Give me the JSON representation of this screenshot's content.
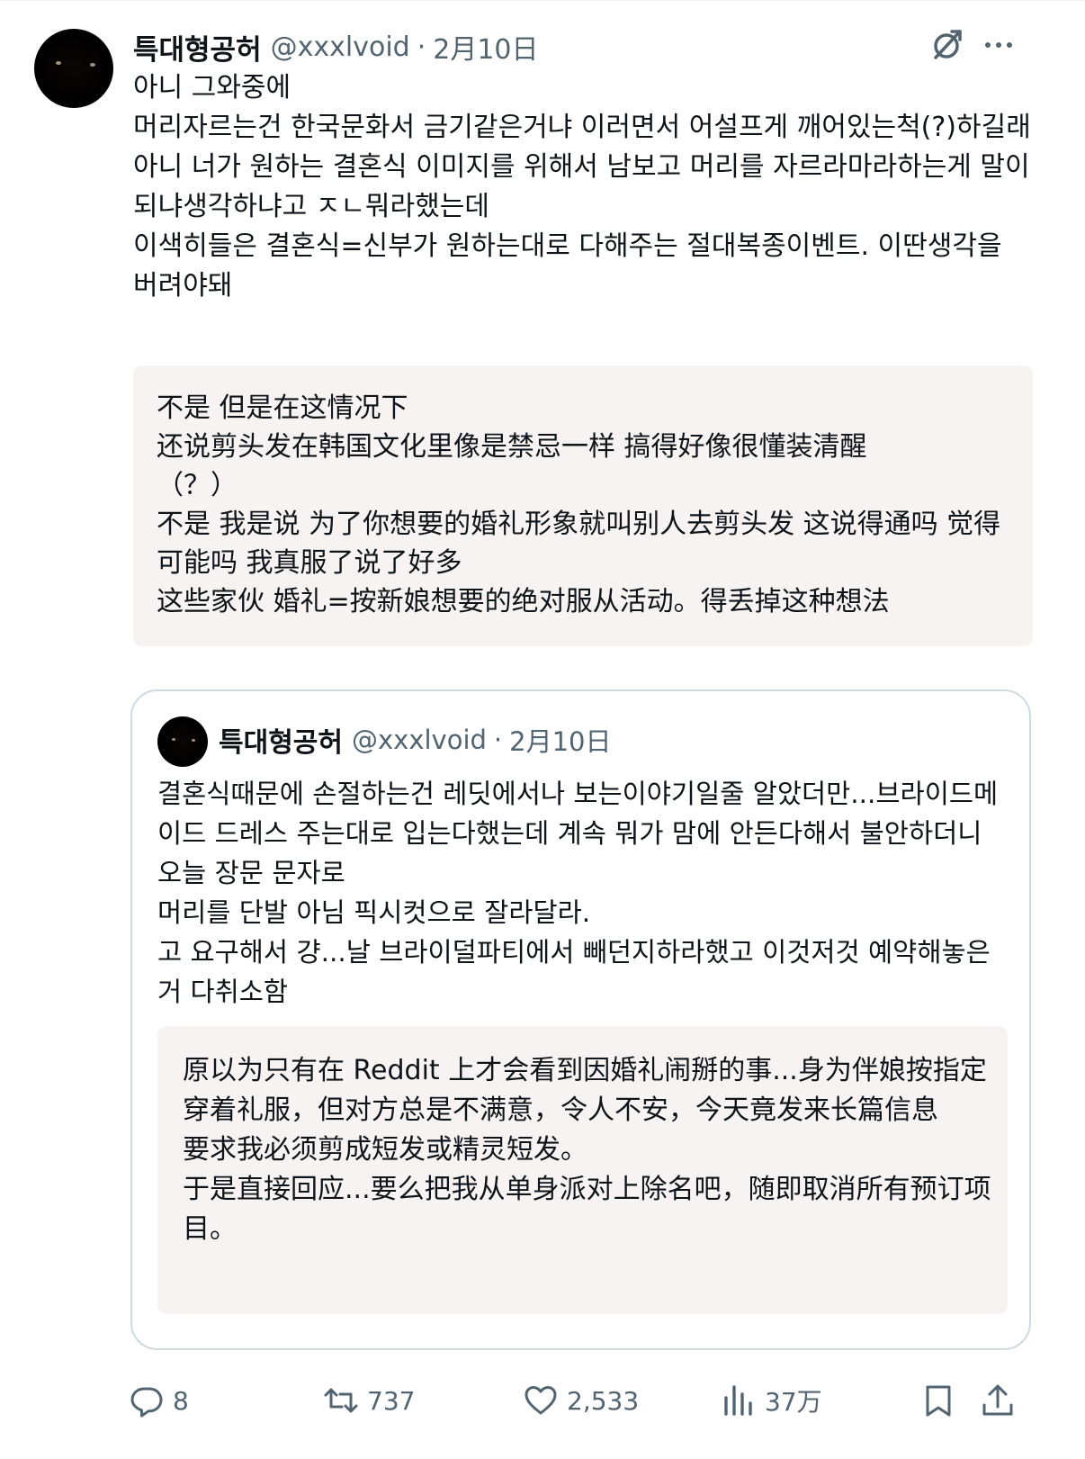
{
  "tweet": {
    "author_name": "특대형공허",
    "handle": "@xxxlvoid",
    "separator": "·",
    "date": "2月10日",
    "text": "아니 그와중에\n머리자르는건 한국문화서 금기같은거냐 이러면서 어설프게 깨어있는척(?)하길래\n아니 너가 원하는 결혼식 이미지를 위해서 남보고 머리를 자르라마라하는게 말이되냐생각하냐고 ㅈㄴ뭐라했는데\n이색히들은 결혼식=신부가 원하는대로 다해주는 절대복종이벤트. 이딴생각을 버려야돼",
    "translation": "不是 但是在这情况下\n还说剪头发在韩国文化里像是禁忌一样 搞得好像很懂装清醒\n（？）\n不是 我是说 为了你想要的婚礼形象就叫别人去剪头发 这说得通吗 觉得可能吗 我真服了说了好多\n这些家伙 婚礼=按新娘想要的绝对服从活动。得丢掉这种想法"
  },
  "quoted": {
    "author_name": "특대형공허",
    "handle": "@xxxlvoid",
    "separator": "·",
    "date": "2月10日",
    "text": "결혼식때문에 손절하는건 레딧에서나 보는이야기일줄 알았더만...브라이드메이드 드레스 주는대로 입는다했는데 계속 뭐가 맘에 안든다해서 불안하더니 오늘 장문 문자로\n머리를 단발 아님 픽시컷으로 잘라달라.\n고 요구해서 걍...날 브라이덜파티에서 빼던지하라했고 이것저것 예약해놓은거 다취소함",
    "translation": "原以为只有在 Reddit 上才会看到因婚礼闹掰的事...身为伴娘按指定穿着礼服，但对方总是不满意，令人不安，今天竟发来长篇信息\n要求我必须剪成短发或精灵短发。\n于是直接回应...要么把我从单身派对上除名吧，随即取消所有预订项目。"
  },
  "actions": {
    "replies": "8",
    "retweets": "737",
    "likes": "2,533",
    "views": "37万"
  },
  "icons": {
    "top_right": [
      "grok-icon",
      "more-icon"
    ],
    "action_bar": [
      "reply-icon",
      "retweet-icon",
      "like-icon",
      "views-icon",
      "bookmark-icon",
      "share-icon"
    ]
  },
  "colors": {
    "text": "#0f1419",
    "secondary": "#536471",
    "translation_bg": "#f7f3f3",
    "border": "#cfd9de"
  }
}
